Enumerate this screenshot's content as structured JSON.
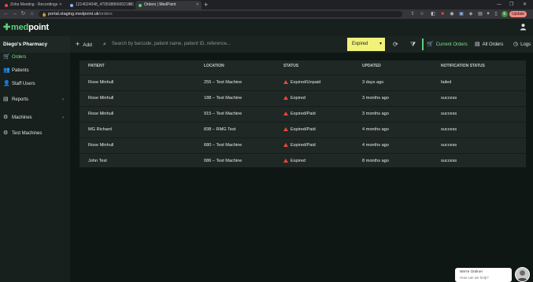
{
  "browser": {
    "tabs": [
      {
        "label": "Zoho Meeting - Recordings",
        "active": false,
        "favicon_color": "#e44c3c"
      },
      {
        "label": "1214024048_4795088660021983",
        "active": false,
        "favicon_color": "#8ab4f8"
      },
      {
        "label": "Orders | MedPoint",
        "active": true,
        "favicon_color": "#5bd07a"
      }
    ],
    "new_tab": "+",
    "address": {
      "host": "portal.staging.medpoint.uk",
      "path": "/orders"
    },
    "profile_initial": "E",
    "update_label": "Update"
  },
  "app": {
    "brand": {
      "plus": "✚",
      "med": "med",
      "point": "point"
    },
    "pharmacy_name": "Diego's Pharmacy"
  },
  "toolbar": {
    "add_label": "Add",
    "search_placeholder": "Search by barcode, patient name, patient ID, reference...",
    "status_filter": "Expired",
    "current_orders": "Current Orders",
    "all_orders": "All Orders",
    "logs": "Logs"
  },
  "sidebar": {
    "items": [
      {
        "label": "Orders",
        "icon": "cart-icon",
        "active": true
      },
      {
        "label": "Patients",
        "icon": "users-icon"
      },
      {
        "label": "Staff Users",
        "icon": "staff-icon"
      },
      {
        "label": "Reports",
        "icon": "reports-icon",
        "chevron": true
      },
      {
        "label": "Machines",
        "icon": "machines-icon",
        "chevron": true
      },
      {
        "label": "Test Machines",
        "icon": "gear-icon"
      }
    ]
  },
  "table": {
    "columns": [
      "Patient",
      "Location",
      "Status",
      "Updated",
      "Notification Status"
    ],
    "rows": [
      {
        "patient": "Rose Minhull",
        "location": "255 – Test Machine",
        "status": "Expired/Unpaid",
        "updated": "3 days ago",
        "notification": "failed"
      },
      {
        "patient": "Rose Minhull",
        "location": "188 – Test Machine",
        "status": "Expired",
        "updated": "3 months ago",
        "notification": "success"
      },
      {
        "patient": "Rose Minhull",
        "location": "915 – Test Machine",
        "status": "Expired/Paid",
        "updated": "3 months ago",
        "notification": "success"
      },
      {
        "patient": "MG Richard",
        "location": "838 – RMG Test",
        "status": "Expired/Paid",
        "updated": "4 months ago",
        "notification": "success"
      },
      {
        "patient": "Rose Minhull",
        "location": "680 – Test Machine",
        "status": "Expired/Paid",
        "updated": "4 months ago",
        "notification": "success"
      },
      {
        "patient": "John Test",
        "location": "086 – Test Machine",
        "status": "Expired",
        "updated": "8 months ago",
        "notification": "success"
      }
    ]
  },
  "chat": {
    "title": "We're Online!",
    "subtitle": "How can we help?"
  },
  "colors": {
    "accent": "#5bd07a",
    "filter_bg": "#f2f27a",
    "warning": "#e8463b"
  }
}
